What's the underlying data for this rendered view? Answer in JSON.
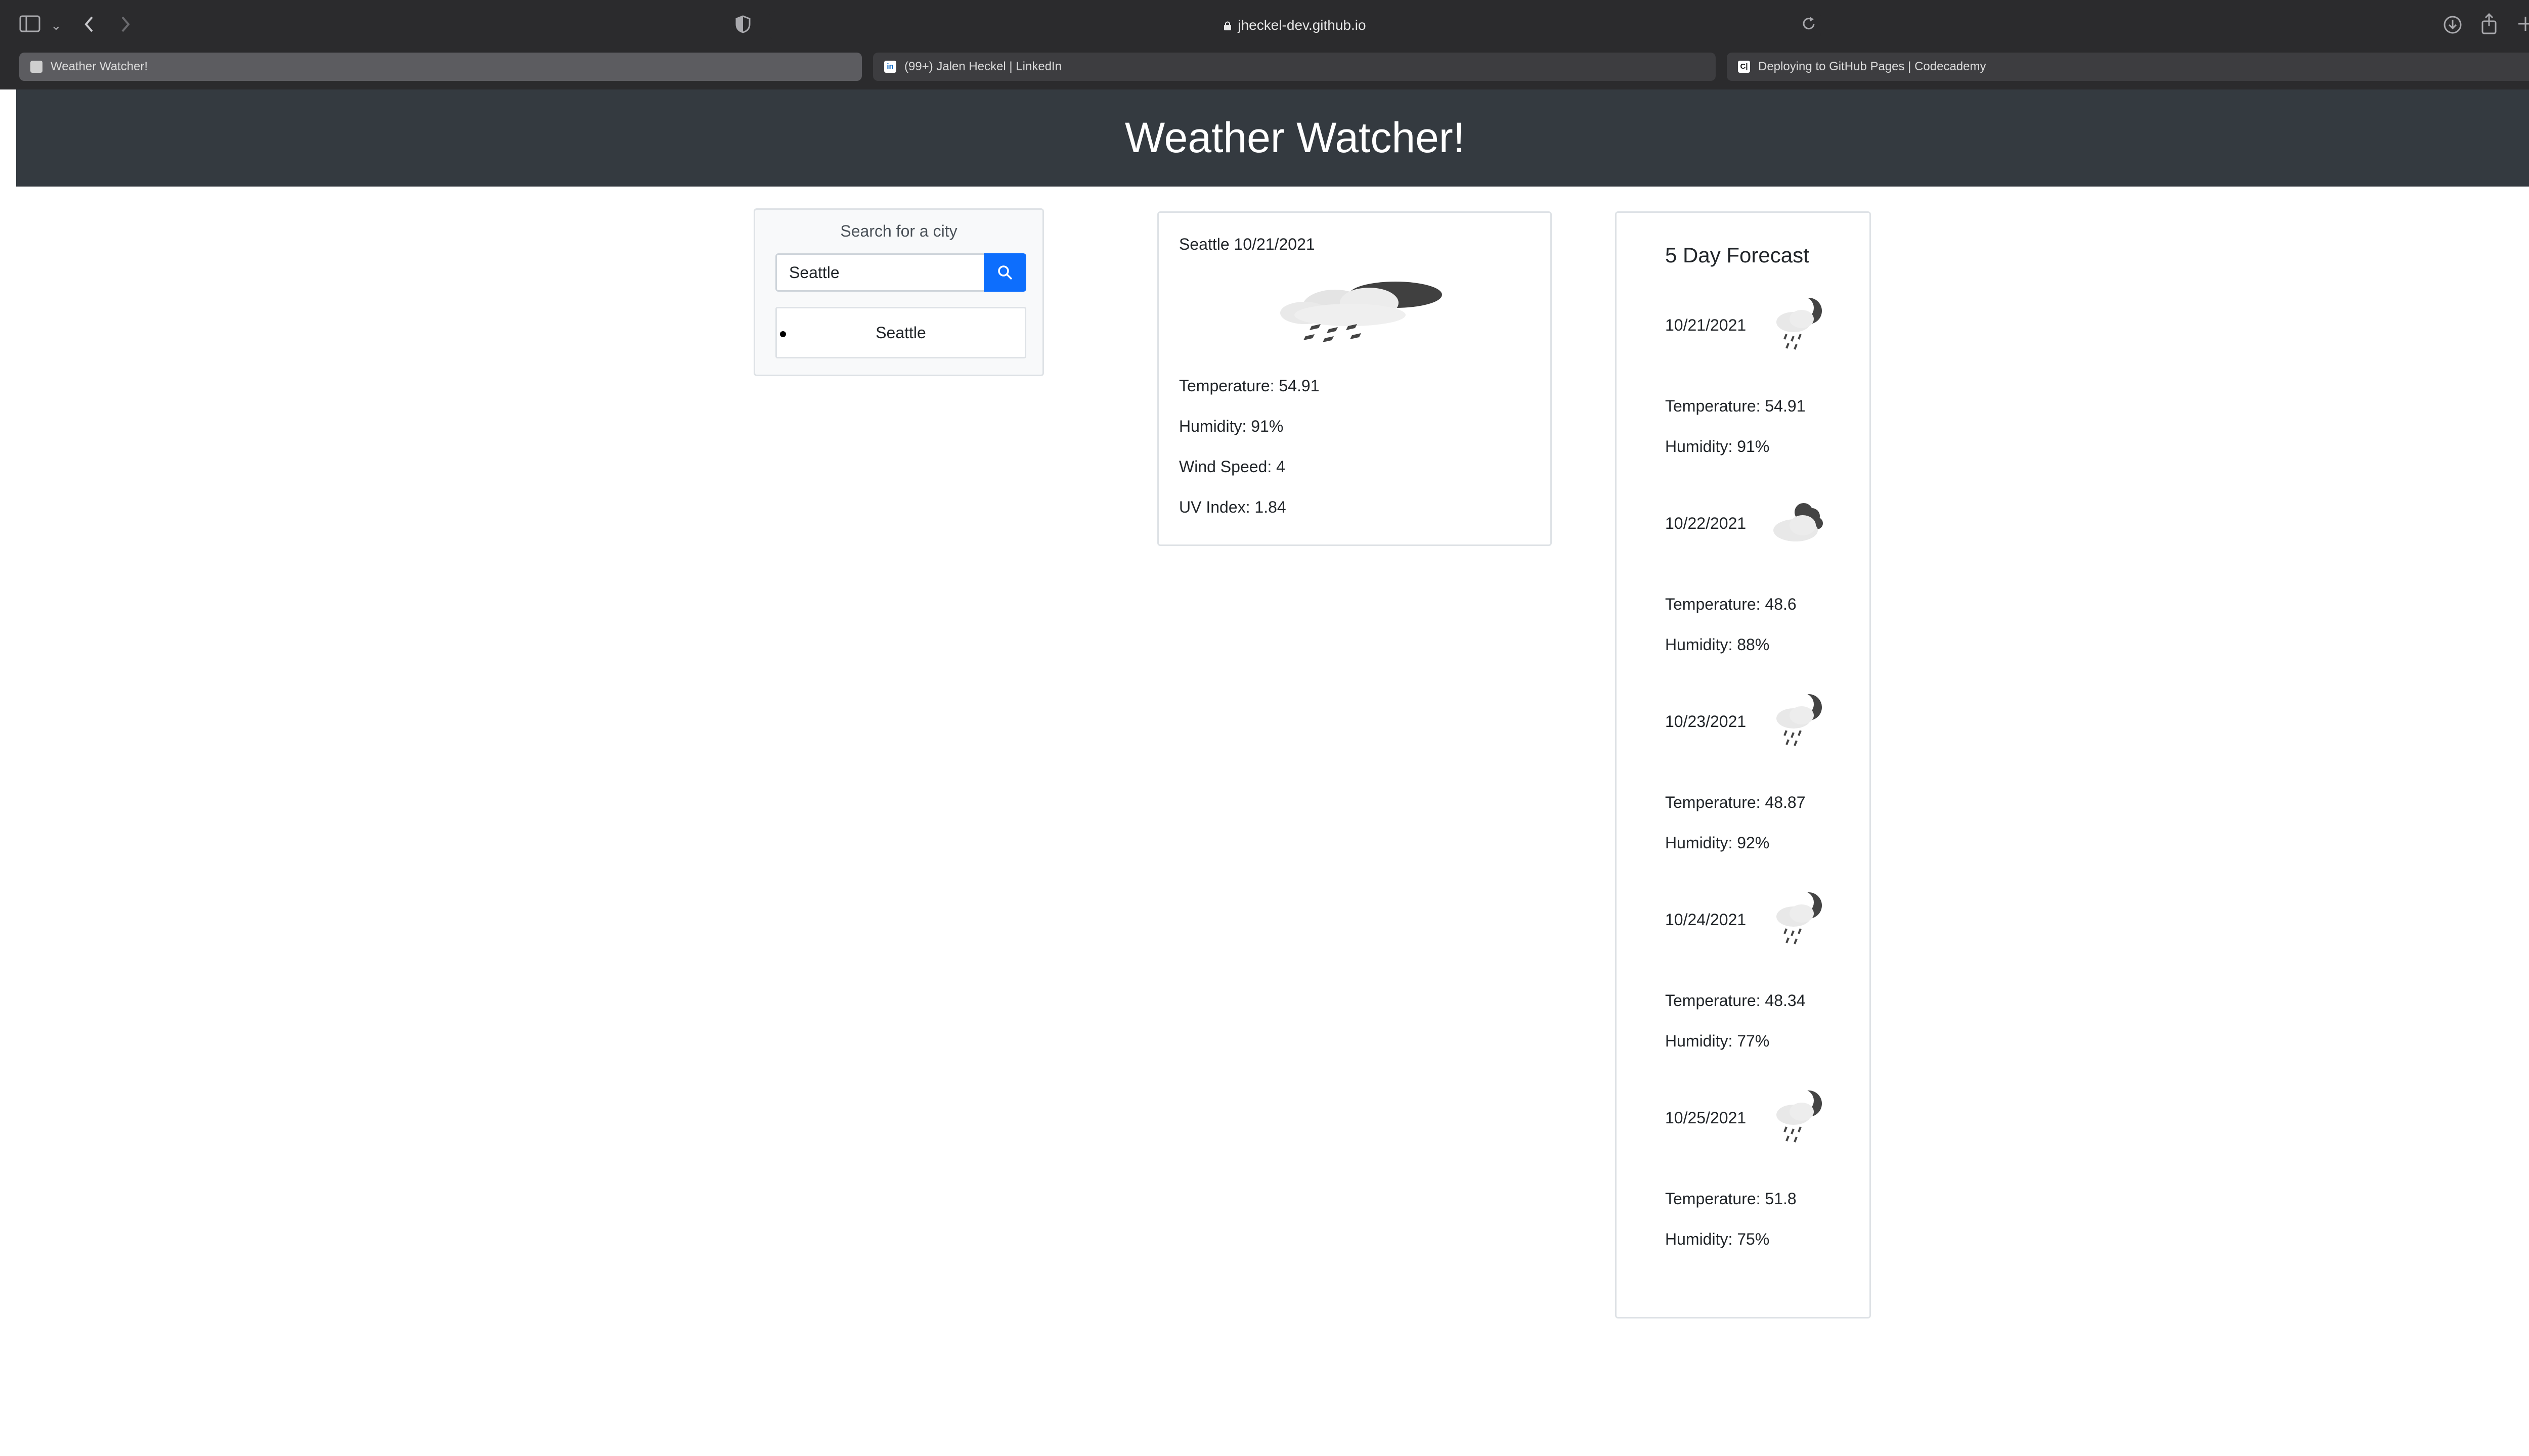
{
  "browser": {
    "url": "jheckel-dev.github.io",
    "tabs": [
      {
        "label": "Weather Watcher!",
        "favicon": "page-favicon",
        "active": true
      },
      {
        "label": "(99+) Jalen Heckel | LinkedIn",
        "favicon": "linkedin-favicon",
        "favicon_text": "in",
        "active": false
      },
      {
        "label": "Deploying to GitHub Pages | Codecademy",
        "favicon": "codecademy-favicon",
        "favicon_text": "C|",
        "active": false
      }
    ]
  },
  "header": {
    "title": "Weather Watcher!"
  },
  "search": {
    "title": "Search for a city",
    "input_value": "Seattle",
    "button_icon": "search-icon",
    "history": [
      "Seattle"
    ]
  },
  "current": {
    "heading": "Seattle 10/21/2021",
    "icon": "rain-cloud-icon",
    "temperature": "Temperature: 54.91",
    "humidity": "Humidity: 91%",
    "wind": "Wind Speed: 4",
    "uv": "UV Index: 1.84"
  },
  "forecast": {
    "title": "5 Day Forecast",
    "days": [
      {
        "date": "10/21/2021",
        "icon": "night-rain-icon",
        "temperature": "Temperature: 54.91",
        "humidity": "Humidity: 91%"
      },
      {
        "date": "10/22/2021",
        "icon": "night-cloudy-icon",
        "temperature": "Temperature: 48.6",
        "humidity": "Humidity: 88%"
      },
      {
        "date": "10/23/2021",
        "icon": "night-rain-icon",
        "temperature": "Temperature: 48.87",
        "humidity": "Humidity: 92%"
      },
      {
        "date": "10/24/2021",
        "icon": "night-rain-icon",
        "temperature": "Temperature: 48.34",
        "humidity": "Humidity: 77%"
      },
      {
        "date": "10/25/2021",
        "icon": "night-rain-icon",
        "temperature": "Temperature: 51.8",
        "humidity": "Humidity: 75%"
      }
    ]
  },
  "colors": {
    "header_bg": "#343a40",
    "search_button": "#0d6efd",
    "card_border": "#dee2e6"
  }
}
